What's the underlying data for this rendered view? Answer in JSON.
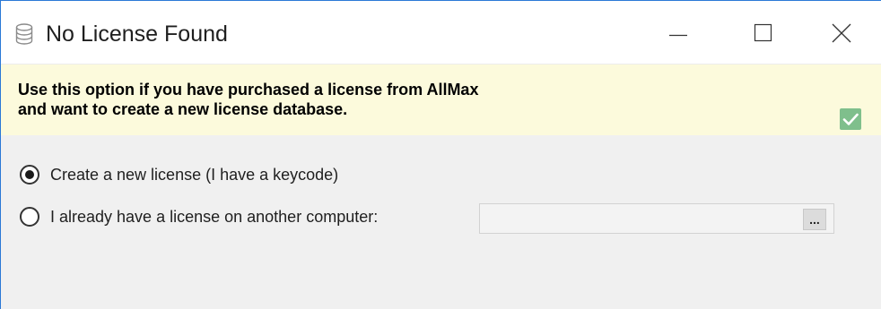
{
  "window": {
    "title": "No License Found",
    "app_icon": "database-icon",
    "controls": {
      "minimize": "minimize-icon",
      "maximize": "maximize-icon",
      "close": "close-icon"
    }
  },
  "banner": {
    "line1": "Use this option if you have purchased a license from AllMax",
    "line2": "and want to create a new license database.",
    "checkbox_checked": true,
    "checkbox_color": "#7fbf8c",
    "background_color": "#fcfadc"
  },
  "options": [
    {
      "label": "Create a new license (I have a keycode)",
      "selected": true
    },
    {
      "label": "I already have a license on another computer:",
      "selected": false
    }
  ],
  "path_field": {
    "value": "",
    "browse_label": "..."
  },
  "colors": {
    "window_border": "#2b79d6",
    "dialog_background": "#f0f0f0"
  }
}
